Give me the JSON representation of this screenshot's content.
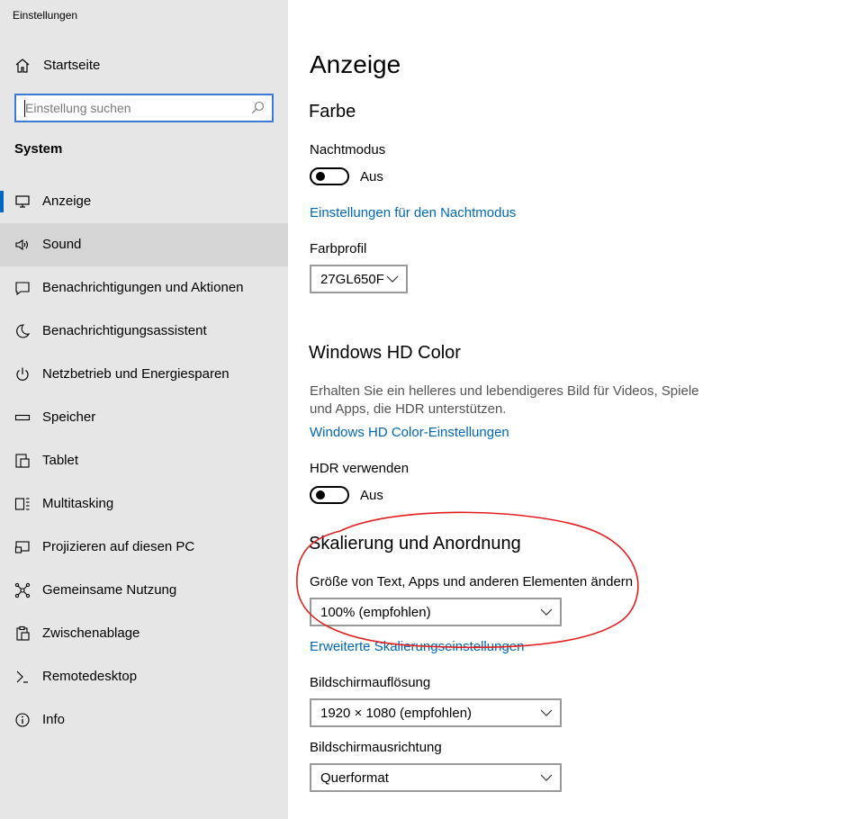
{
  "window": {
    "title": "Einstellungen"
  },
  "sidebar": {
    "home_label": "Startseite",
    "search_placeholder": "Einstellung suchen",
    "section_heading": "System",
    "items": [
      {
        "label": "Anzeige",
        "icon": "monitor-icon"
      },
      {
        "label": "Sound",
        "icon": "speaker-icon"
      },
      {
        "label": "Benachrichtigungen und Aktionen",
        "icon": "notification-icon"
      },
      {
        "label": "Benachrichtigungsassistent",
        "icon": "moon-icon"
      },
      {
        "label": "Netzbetrieb und Energiesparen",
        "icon": "power-icon"
      },
      {
        "label": "Speicher",
        "icon": "storage-icon"
      },
      {
        "label": "Tablet",
        "icon": "tablet-icon"
      },
      {
        "label": "Multitasking",
        "icon": "multitasking-icon"
      },
      {
        "label": "Projizieren auf diesen PC",
        "icon": "project-icon"
      },
      {
        "label": "Gemeinsame Nutzung",
        "icon": "share-icon"
      },
      {
        "label": "Zwischenablage",
        "icon": "clipboard-icon"
      },
      {
        "label": "Remotedesktop",
        "icon": "remote-desktop-icon"
      },
      {
        "label": "Info",
        "icon": "info-icon"
      }
    ],
    "selected": "Anzeige",
    "hovered": "Sound"
  },
  "main": {
    "title": "Anzeige",
    "color": {
      "heading": "Farbe",
      "night_mode_label": "Nachtmodus",
      "night_mode_state": "Aus",
      "night_mode_link": "Einstellungen für den Nachtmodus",
      "profile_label": "Farbprofil",
      "profile_value": "27GL650F"
    },
    "hdr": {
      "heading": "Windows HD Color",
      "description": "Erhalten Sie ein helleres und lebendigeres Bild für Videos, Spiele und Apps, die HDR unterstützen.",
      "link": "Windows HD Color-Einstellungen",
      "use_label": "HDR verwenden",
      "use_state": "Aus"
    },
    "scale": {
      "heading": "Skalierung und Anordnung",
      "size_label": "Größe von Text, Apps und anderen Elementen ändern",
      "size_value": "100% (empfohlen)",
      "advanced_link": "Erweiterte Skalierungseinstellungen",
      "resolution_label": "Bildschirmauflösung",
      "resolution_value": "1920 × 1080 (empfohlen)",
      "orientation_label": "Bildschirmausrichtung",
      "orientation_value": "Querformat"
    }
  },
  "colors": {
    "accent": "#0067c0",
    "link": "#0067b8",
    "sidebar_bg": "#e6e6e6",
    "annotation": "#e02020"
  }
}
